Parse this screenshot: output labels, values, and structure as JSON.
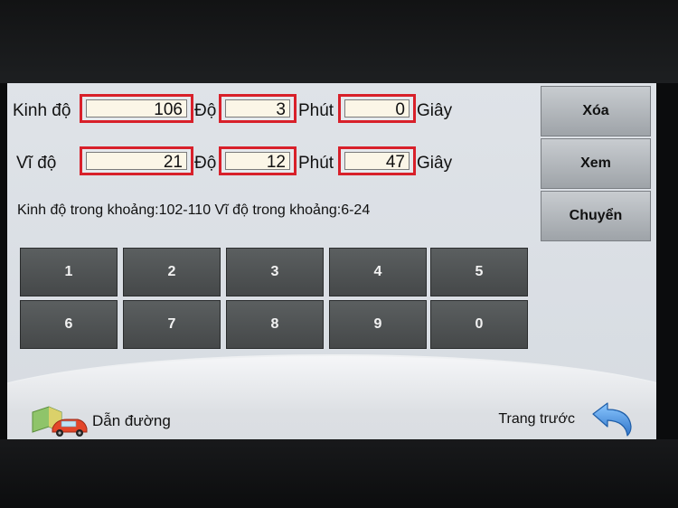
{
  "longitude": {
    "label": "Kinh độ",
    "degrees": "106",
    "degree_unit": "Độ",
    "minutes": "3",
    "minute_unit": "Phút",
    "seconds": "0",
    "second_unit": "Giây"
  },
  "latitude": {
    "label": "Vĩ độ",
    "degrees": "21",
    "degree_unit": "Độ",
    "minutes": "12",
    "minute_unit": "Phút",
    "seconds": "47",
    "second_unit": "Giây"
  },
  "info_text": "Kinh độ trong khoảng:102-110 Vĩ độ trong khoảng:6-24",
  "side_buttons": {
    "delete": "Xóa",
    "view": "Xem",
    "transfer": "Chuyển"
  },
  "keypad": [
    "1",
    "2",
    "3",
    "4",
    "5",
    "6",
    "7",
    "8",
    "9",
    "0"
  ],
  "bottom": {
    "navigate_label": "Dẫn đường",
    "back_label": "Trang trước"
  },
  "colors": {
    "field_highlight": "#d8202a",
    "key_bg": "#4f5354",
    "screen_bg": "#d9dde2",
    "back_arrow": "#3f8fe0"
  },
  "icons": {
    "navigate": "map-car-icon",
    "back": "back-arrow-icon"
  }
}
